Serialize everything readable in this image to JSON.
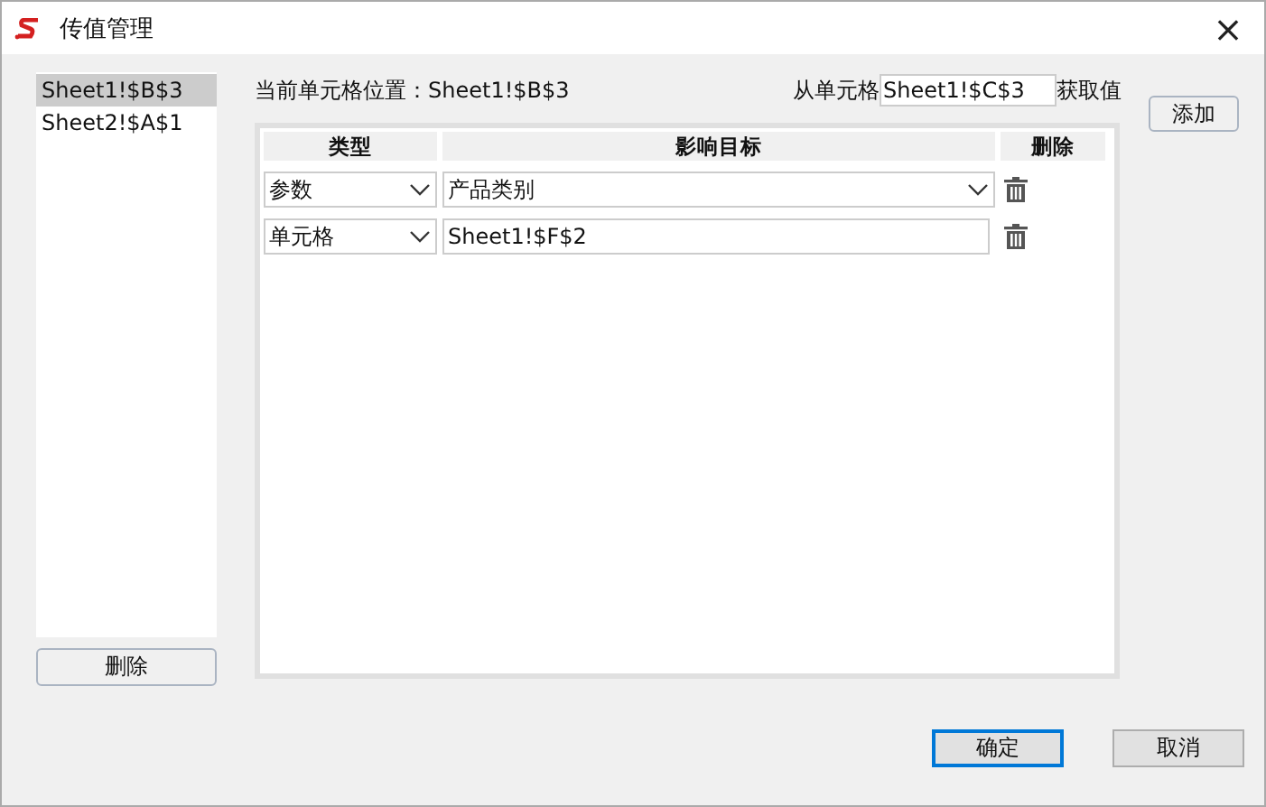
{
  "window": {
    "title": "传值管理",
    "close": "×"
  },
  "cell_list": {
    "items": [
      {
        "label": "Sheet1!$B$3",
        "selected": true
      },
      {
        "label": "Sheet2!$A$1",
        "selected": false
      }
    ],
    "delete_button": "删除"
  },
  "current_cell": "当前单元格位置：Sheet1!$B$3",
  "source": {
    "prefix": "从单元格",
    "value": "Sheet1!$C$3",
    "suffix": "获取值"
  },
  "add_button": "添加",
  "table": {
    "columns": [
      "类型",
      "影响目标",
      "删除"
    ],
    "rows": [
      {
        "type": "参数",
        "target": {
          "kind": "dropdown",
          "value": "产品类别"
        }
      },
      {
        "type": "单元格",
        "target": {
          "kind": "text",
          "value": "Sheet1!$F$2"
        }
      }
    ]
  },
  "buttons": [
    {
      "label": "确定",
      "default": true
    },
    {
      "label": "取消",
      "default": false
    }
  ]
}
